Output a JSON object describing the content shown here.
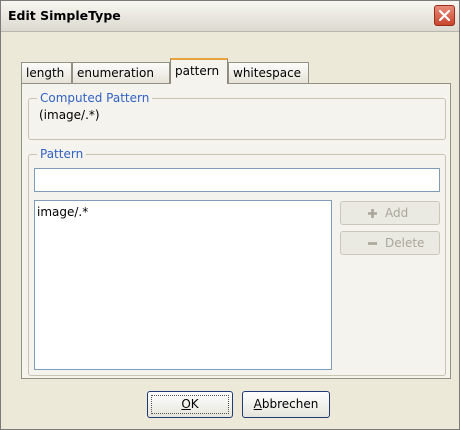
{
  "dialog": {
    "title": "Edit SimpleType",
    "close_icon": "close-icon"
  },
  "tabs": [
    {
      "label": "length"
    },
    {
      "label": "enumeration"
    },
    {
      "label": "pattern",
      "active": true
    },
    {
      "label": "whitespace"
    }
  ],
  "computed": {
    "legend": "Computed Pattern",
    "value": "(image/.*)"
  },
  "pattern": {
    "legend": "Pattern",
    "input_value": "",
    "items": [
      "image/.*"
    ],
    "add_label": "Add",
    "add_icon": "plus-icon",
    "delete_label": "Delete",
    "delete_icon": "minus-icon"
  },
  "buttons": {
    "ok_mnemonic": "O",
    "ok_rest": "K",
    "cancel_mnemonic": "A",
    "cancel_rest": "bbrechen"
  },
  "colors": {
    "legend": "#3262c4",
    "close_button": "#c9452d",
    "active_tab_accent": "#e8a33c"
  }
}
